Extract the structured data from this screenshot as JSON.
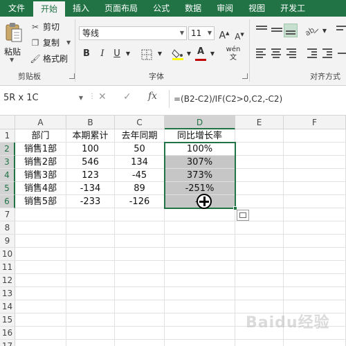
{
  "tabs": [
    {
      "label": "文件"
    },
    {
      "label": "开始"
    },
    {
      "label": "插入"
    },
    {
      "label": "页面布局"
    },
    {
      "label": "公式"
    },
    {
      "label": "数据"
    },
    {
      "label": "审阅"
    },
    {
      "label": "视图"
    },
    {
      "label": "开发工"
    }
  ],
  "clipboard": {
    "paste": "粘贴",
    "cut": "剪切",
    "copy": "复制",
    "format_painter": "格式刷",
    "group_label": "剪贴板"
  },
  "font": {
    "name": "等线",
    "size": "11",
    "bold": "B",
    "italic": "I",
    "underline": "U",
    "group_label": "字体"
  },
  "alignment": {
    "group_label": "对齐方式"
  },
  "formula_bar": {
    "name_box": "5R x 1C",
    "formula": "=(B2-C2)/IF(C2>0,C2,-C2)"
  },
  "columns": [
    "A",
    "B",
    "C",
    "D",
    "E",
    "F"
  ],
  "rows": [
    "1",
    "2",
    "3",
    "4",
    "5",
    "6",
    "7",
    "8",
    "9",
    "10",
    "11",
    "12",
    "13",
    "14",
    "15",
    "16",
    "17"
  ],
  "table": {
    "headers": [
      "部门",
      "本期累计",
      "去年同期",
      "同比增长率"
    ],
    "data": [
      [
        "销售1部",
        "100",
        "50",
        "100%"
      ],
      [
        "销售2部",
        "546",
        "134",
        "307%"
      ],
      [
        "销售3部",
        "123",
        "-45",
        "373%"
      ],
      [
        "销售4部",
        "-134",
        "89",
        "-251%"
      ],
      [
        "销售5部",
        "-233",
        "-126",
        "-8"
      ]
    ]
  },
  "colors": {
    "accent": "#217346",
    "selection_fill": "#c6c6c6"
  },
  "watermark": "Baidu经验"
}
